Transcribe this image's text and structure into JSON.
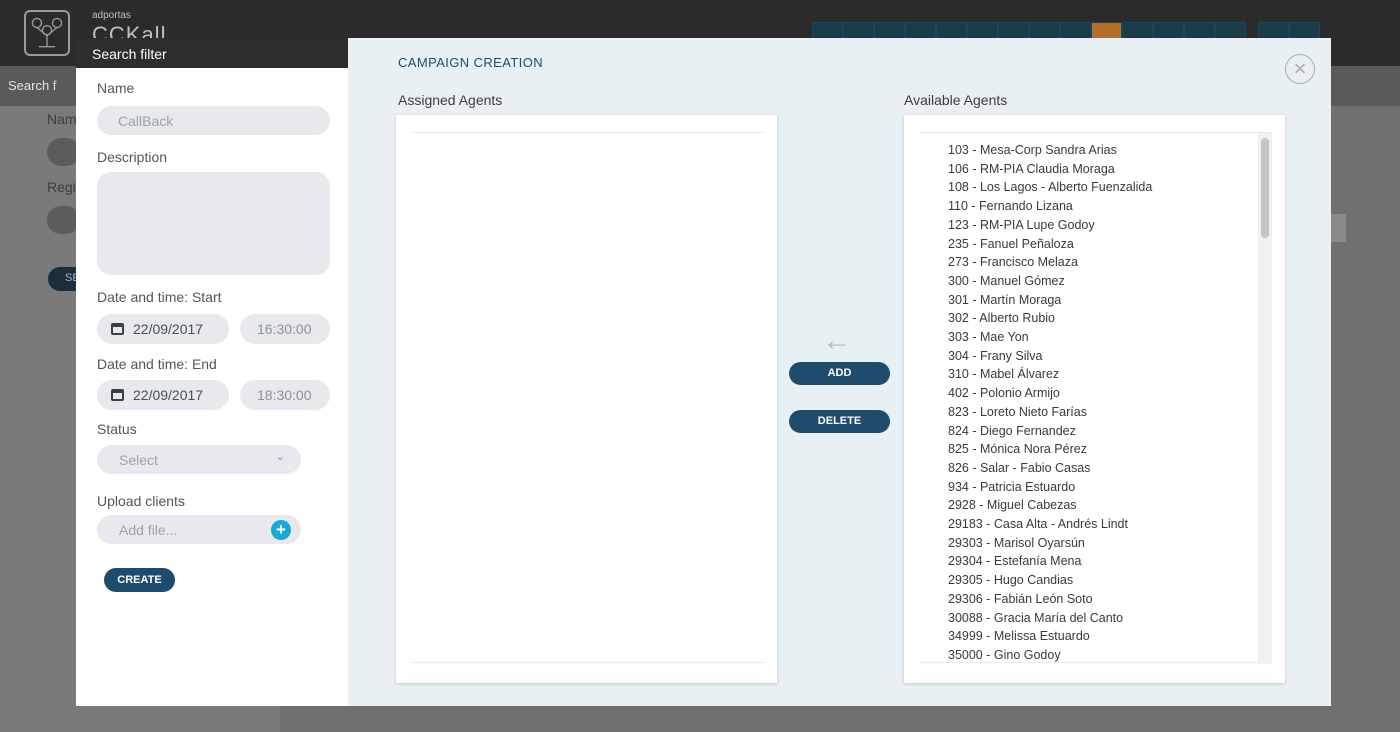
{
  "app": {
    "brand_small": "adportas",
    "brand_big": "CCKall"
  },
  "background": {
    "subbar_label": "Search f",
    "labels": [
      "Nam",
      "Regi"
    ],
    "search_btn": "SE"
  },
  "filter": {
    "title": "Search filter",
    "name_label": "Name",
    "name_placeholder": "CallBack",
    "description_label": "Description",
    "start_label": "Date and time: Start",
    "start_date": "22/09/2017",
    "start_time": "16:30:00",
    "end_label": "Date and time: End",
    "end_date": "22/09/2017",
    "end_time": "18:30:00",
    "status_label": "Status",
    "status_value": "Select",
    "upload_label": "Upload clients",
    "upload_placeholder": "Add file...",
    "create_label": "CREATE"
  },
  "modal": {
    "title": "CAMPAIGN CREATION",
    "close_glyph": "×",
    "assigned_label": "Assigned Agents",
    "available_label": "Available Agents",
    "assigned_agents": [],
    "arrow_glyph": "←",
    "add_label": "ADD",
    "delete_label": "DELETE",
    "available_agents": [
      "103 - Mesa-Corp Sandra Arias",
      "106 - RM-PIA Claudia Moraga",
      "108 - Los Lagos - Alberto Fuenzalida",
      "110 - Fernando Lizana",
      "123 - RM-PIA Lupe Godoy",
      "235 - Fanuel Peñaloza",
      "273 - Francisco Melaza",
      "300 - Manuel Gómez",
      "301 - Martín Moraga",
      "302 - Alberto Rubio",
      "303 - Mae Yon",
      "304 - Frany Silva",
      "310 - Mabel Álvarez",
      "402 - Polonio Armijo",
      "823 - Loreto Nieto Farías",
      "824 - Diego Fernandez",
      "825 - Mónica Nora Pérez",
      "826 - Salar - Fabio Casas",
      "934 - Patricia Estuardo",
      "2928 - Miguel Cabezas",
      "29183 - Casa Alta - Andrés Lindt",
      "29303 - Marisol Oyarsún",
      "29304 - Estefanía Mena",
      "29305 - Hugo Candias",
      "29306 - Fabián León Soto",
      "30088 - Gracia María del Canto",
      "34999 - Melissa Estuardo",
      "35000 - Gino Godoy"
    ]
  },
  "top_icons": [
    {
      "icon": "search-icon",
      "glyph": "○"
    },
    {
      "icon": "mail-icon",
      "glyph": "✉"
    },
    {
      "icon": "users-icon",
      "glyph": "⚇"
    },
    {
      "icon": "user-icon",
      "glyph": "♙"
    },
    {
      "icon": "list-icon",
      "glyph": "☰"
    },
    {
      "icon": "home-icon",
      "glyph": "⌂"
    },
    {
      "icon": "toggle-icon",
      "glyph": "◐"
    },
    {
      "icon": "group-icon",
      "glyph": "♧"
    },
    {
      "icon": "pin-icon",
      "glyph": "⚲"
    },
    {
      "icon": "agents-icon",
      "glyph": "⚇",
      "active": true
    },
    {
      "icon": "clock-icon",
      "glyph": "◷"
    },
    {
      "icon": "document-icon",
      "glyph": "▤"
    },
    {
      "icon": "checklist-icon",
      "glyph": "☷"
    },
    {
      "icon": "chart-icon",
      "glyph": "◔"
    },
    {
      "icon": "settings-icon",
      "glyph": "⚙",
      "gear": true
    },
    {
      "icon": "logout-icon",
      "glyph": "⇥"
    }
  ],
  "colors": {
    "accent": "#1f4b6c",
    "active_nav": "#b4702a",
    "upload_plus": "#19a8d7"
  }
}
